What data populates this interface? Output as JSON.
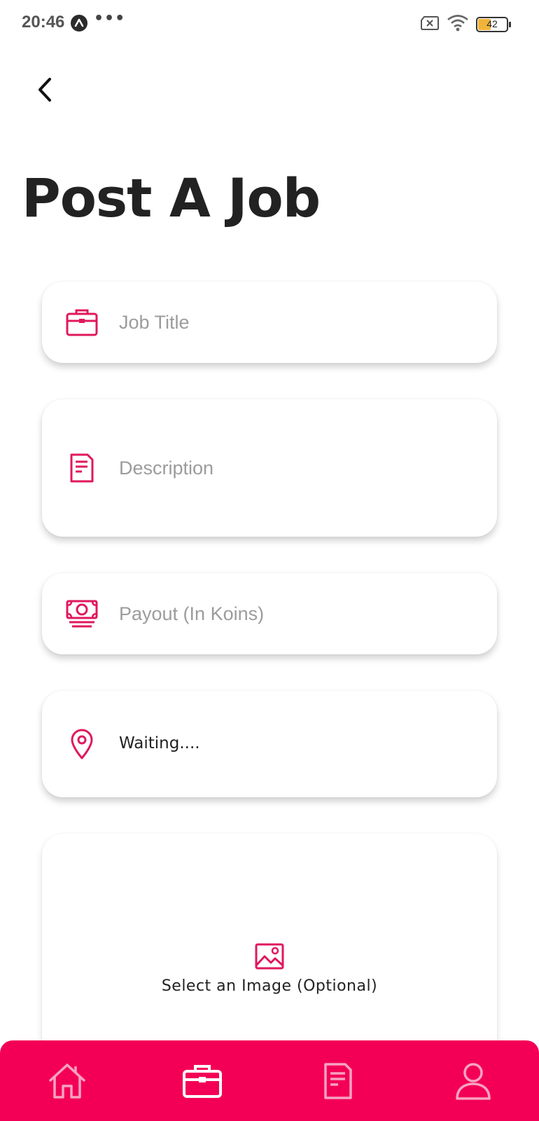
{
  "status_bar": {
    "time": "20:46",
    "dots": "•••",
    "battery_level": "42"
  },
  "header": {
    "title": "Post A Job"
  },
  "form": {
    "job_title_placeholder": "Job Title",
    "description_placeholder": "Description",
    "payout_placeholder": "Payout (In Koins)",
    "location_value": "Waiting....",
    "image_label": "Select an Image (Optional)"
  },
  "icons": {
    "job_title": "briefcase-icon",
    "description": "document-icon",
    "payout": "money-icon",
    "location": "location-pin-icon",
    "image": "image-icon"
  },
  "bottom_nav": {
    "items": [
      "home",
      "jobs",
      "documents",
      "profile"
    ],
    "active": "jobs"
  },
  "colors": {
    "accent": "#e0185e",
    "nav_background": "#f30056",
    "nav_icon_inactive": "#f7a2c0",
    "nav_icon_active": "#ffffff"
  }
}
